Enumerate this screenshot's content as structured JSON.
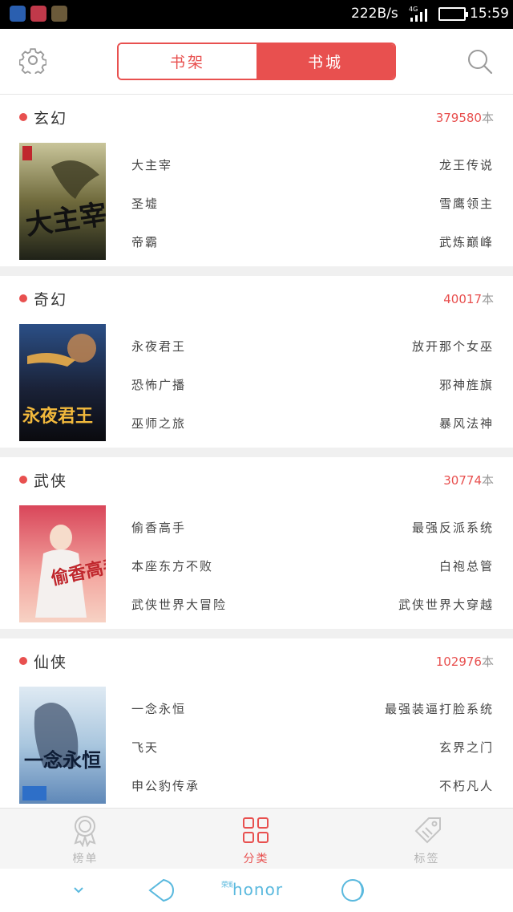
{
  "status_bar": {
    "net_speed": "222B/s",
    "network": "4G",
    "time": "15:59",
    "app_icon_colors": [
      "#2a5fb0",
      "#c0394a",
      "#6b5a3a"
    ]
  },
  "header": {
    "tabs": [
      {
        "label": "书架",
        "active": false
      },
      {
        "label": "书城",
        "active": true
      }
    ],
    "accent_color": "#e8504f"
  },
  "categories": [
    {
      "name": "玄幻",
      "count": "379580",
      "unit": "本",
      "cover_label": "大主宰",
      "books_left": [
        "大主宰",
        "圣墟",
        "帝霸"
      ],
      "books_right": [
        "龙王传说",
        "雪鹰领主",
        "武炼巅峰"
      ]
    },
    {
      "name": "奇幻",
      "count": "40017",
      "unit": "本",
      "cover_label": "永夜君王",
      "books_left": [
        "永夜君王",
        "恐怖广播",
        "巫师之旅"
      ],
      "books_right": [
        "放开那个女巫",
        "邪神旌旗",
        "暴风法神"
      ]
    },
    {
      "name": "武侠",
      "count": "30774",
      "unit": "本",
      "cover_label": "偷香高手",
      "books_left": [
        "偷香高手",
        "本座东方不败",
        "武侠世界大冒险"
      ],
      "books_right": [
        "最强反派系统",
        "白袍总管",
        "武侠世界大穿越"
      ]
    },
    {
      "name": "仙侠",
      "count": "102976",
      "unit": "本",
      "cover_label": "一念永恒",
      "books_left": [
        "一念永恒",
        "飞天",
        "申公豹传承"
      ],
      "books_right": [
        "最强装逼打脸系统",
        "玄界之门",
        "不朽凡人"
      ]
    }
  ],
  "bottom_tabs": [
    {
      "label": "榜单",
      "icon": "ribbon-award-icon",
      "active": false
    },
    {
      "label": "分类",
      "icon": "grid-category-icon",
      "active": true
    },
    {
      "label": "标签",
      "icon": "tag-icon",
      "active": false
    }
  ],
  "system_nav": {
    "brand": "honor",
    "brand_prefix": "荣耀"
  }
}
